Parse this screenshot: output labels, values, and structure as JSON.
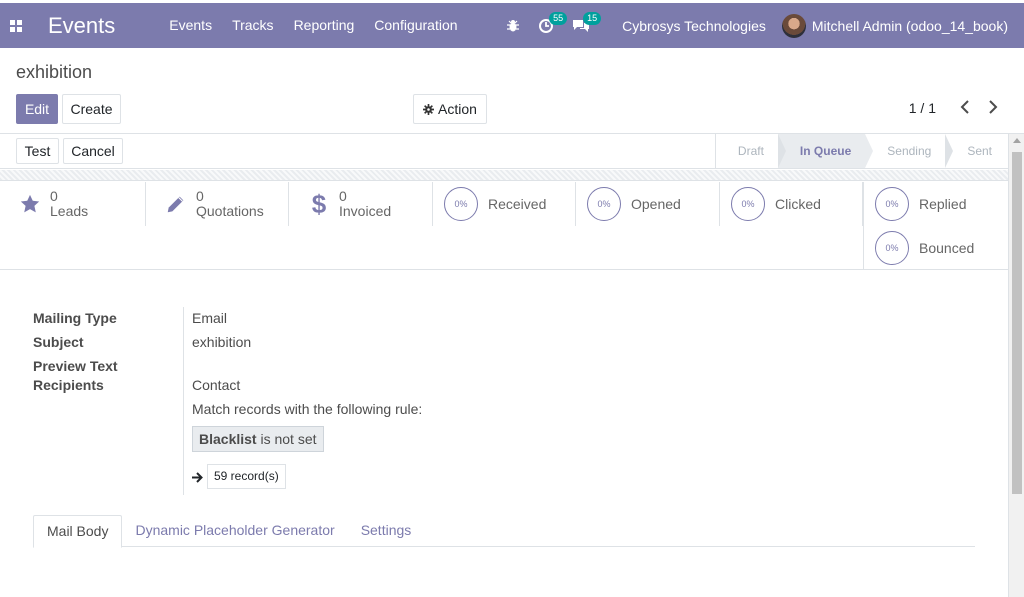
{
  "navbar": {
    "app_title": "Events",
    "menu": [
      "Events",
      "Tracks",
      "Reporting",
      "Configuration"
    ],
    "activity_count": "55",
    "messages_count": "15",
    "company": "Cybrosys Technologies",
    "user": "Mitchell Admin (odoo_14_book)"
  },
  "control_panel": {
    "breadcrumb": "exhibition",
    "edit_label": "Edit",
    "create_label": "Create",
    "action_label": "Action",
    "pager": "1 / 1"
  },
  "statusbar": {
    "test_label": "Test",
    "cancel_label": "Cancel",
    "stages": [
      "Draft",
      "In Queue",
      "Sending",
      "Sent"
    ],
    "active_stage": "In Queue"
  },
  "stats": {
    "leads": {
      "count": "0",
      "label": "Leads"
    },
    "quotations": {
      "count": "0",
      "label": "Quotations"
    },
    "invoiced": {
      "count": "0",
      "label": "Invoiced"
    },
    "received": {
      "pct": "0%",
      "label": "Received"
    },
    "opened": {
      "pct": "0%",
      "label": "Opened"
    },
    "clicked": {
      "pct": "0%",
      "label": "Clicked"
    },
    "replied": {
      "pct": "0%",
      "label": "Replied"
    },
    "bounced": {
      "pct": "0%",
      "label": "Bounced"
    }
  },
  "form": {
    "mailing_type_label": "Mailing Type",
    "mailing_type": "Email",
    "subject_label": "Subject",
    "subject": "exhibition",
    "preview_label": "Preview Text",
    "recipients_label": "Recipients",
    "recipients": "Contact",
    "rule_intro": "Match records with the following rule:",
    "rule_field": "Blacklist",
    "rule_op": "is not set",
    "records": "59 record(s)"
  },
  "tabs": [
    "Mail Body",
    "Dynamic Placeholder Generator",
    "Settings"
  ],
  "colors": {
    "brand": "#7c7bad",
    "teal": "#00a09d"
  }
}
